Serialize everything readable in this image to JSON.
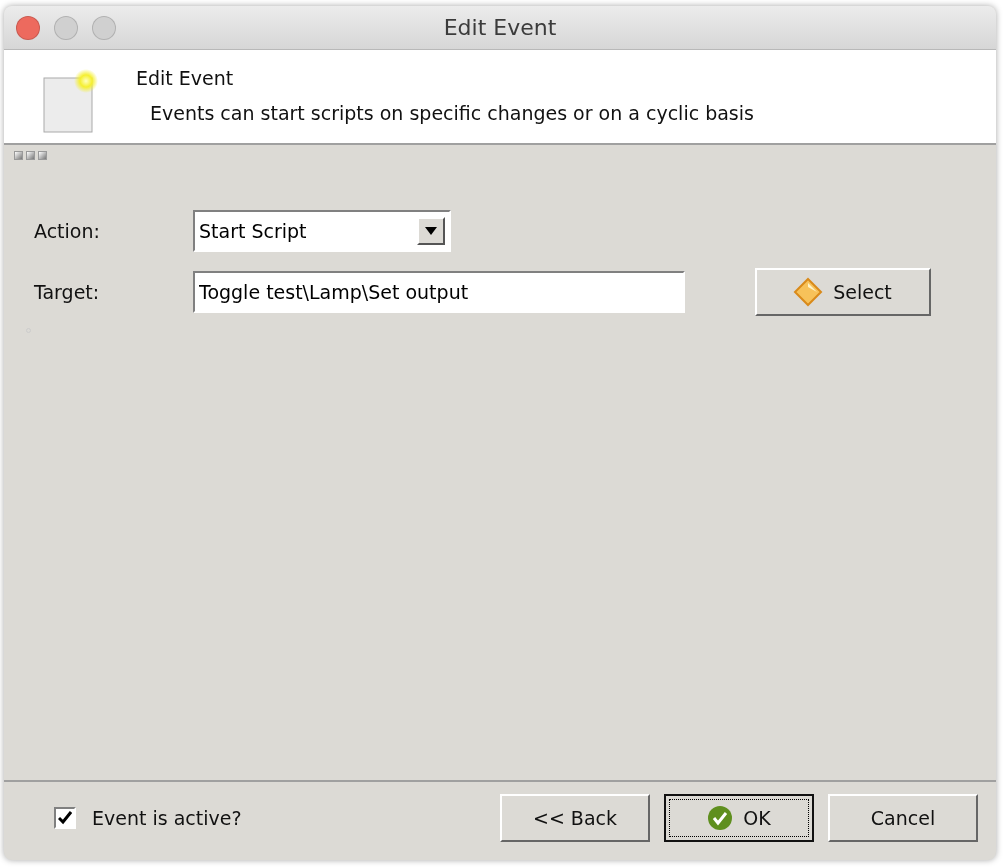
{
  "window": {
    "title": "Edit Event"
  },
  "header": {
    "title": "Edit Event",
    "description": "Events can start scripts on specific changes or on a cyclic basis"
  },
  "form": {
    "action": {
      "label": "Action:",
      "value": "Start Script"
    },
    "target": {
      "label": "Target:",
      "value": "Toggle test\\Lamp\\Set output",
      "button": "Select"
    }
  },
  "footer": {
    "active": {
      "label": "Event is active?",
      "checked": true
    },
    "buttons": [
      {
        "label": "<< Back",
        "kind": "plain",
        "focused": false
      },
      {
        "label": "OK",
        "kind": "ok",
        "focused": true
      },
      {
        "label": "Cancel",
        "kind": "plain",
        "focused": false
      }
    ]
  }
}
